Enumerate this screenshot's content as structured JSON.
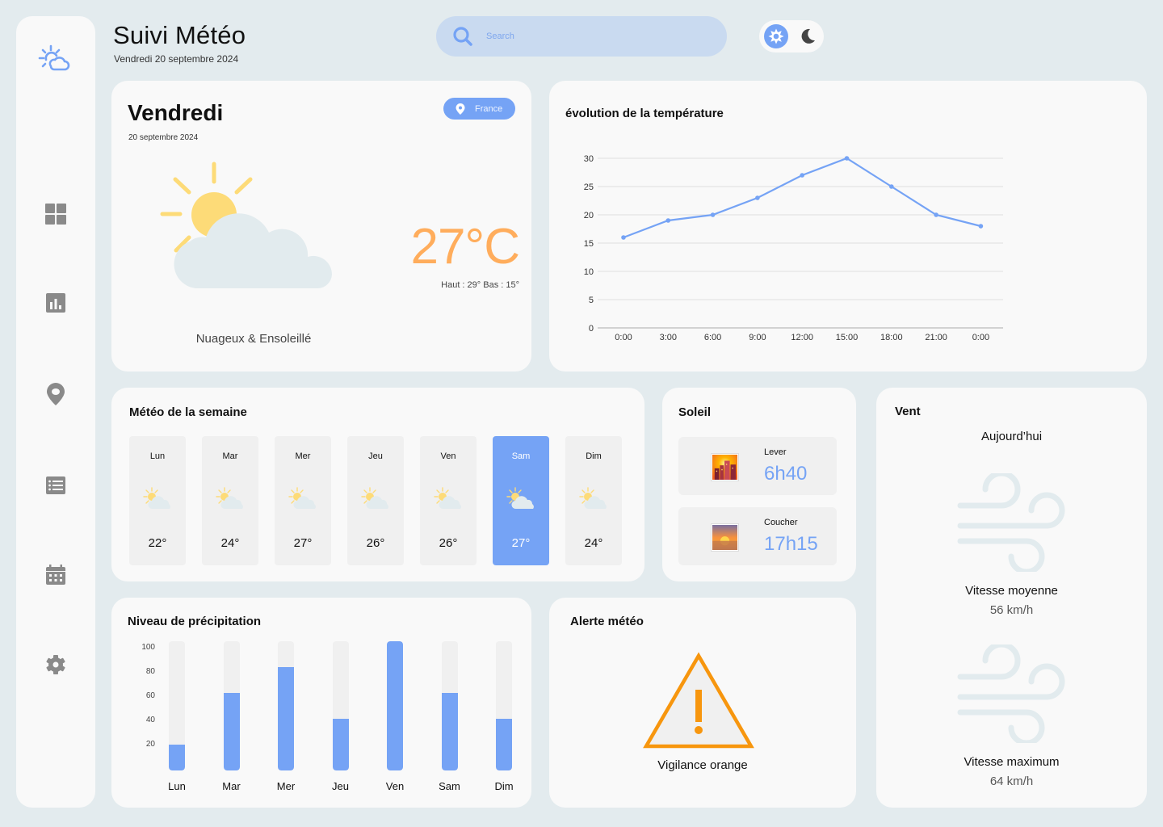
{
  "app": {
    "title": "Suivi Météo",
    "date": "Vendredi 20 septembre 2024"
  },
  "sidebar": {
    "logo": "sun-cloud-icon",
    "items": [
      {
        "id": "dashboard",
        "icon": "grid-icon"
      },
      {
        "id": "stats",
        "icon": "bar-chart-icon"
      },
      {
        "id": "location",
        "icon": "map-pin-icon"
      },
      {
        "id": "list",
        "icon": "list-icon"
      },
      {
        "id": "calendar",
        "icon": "calendar-icon"
      },
      {
        "id": "settings",
        "icon": "gear-icon"
      }
    ]
  },
  "search": {
    "placeholder": "Search",
    "value": ""
  },
  "theme": {
    "light_icon": "sun-icon",
    "dark_icon": "moon-icon",
    "active": "light"
  },
  "today": {
    "day": "Vendredi",
    "date": "20 septembre 2024",
    "location": "France",
    "temperature": "27°C",
    "hi_lo": "Haut : 29° Bas : 15°",
    "condition": "Nuageux & Ensoleillé",
    "icon": "partly-cloudy-icon"
  },
  "colors": {
    "accent": "#75a3f5",
    "temperature": "#ffad5c",
    "sun": "#fddb78",
    "cloud": "#e2ebee",
    "alert": "#f7960e",
    "background": "#e3ebee",
    "card": "#f9f9f9"
  },
  "chart_data": {
    "type": "line",
    "title": "évolution de la température",
    "xlabel": "",
    "ylabel": "",
    "categories": [
      "0:00",
      "3:00",
      "6:00",
      "9:00",
      "12:00",
      "15:00",
      "18:00",
      "21:00",
      "0:00"
    ],
    "series": [
      {
        "name": "Température",
        "values": [
          16,
          19,
          20,
          23,
          27,
          30,
          25,
          20,
          18
        ]
      }
    ],
    "yticks": [
      0,
      5,
      10,
      15,
      20,
      25,
      30
    ],
    "ylim": [
      0,
      30
    ],
    "grid": true,
    "legend": "none"
  },
  "week": {
    "title": "Météo de la semaine",
    "days": [
      {
        "name": "Lun",
        "temp": "22°",
        "active": false
      },
      {
        "name": "Mar",
        "temp": "24°",
        "active": false
      },
      {
        "name": "Mer",
        "temp": "27°",
        "active": false
      },
      {
        "name": "Jeu",
        "temp": "26°",
        "active": false
      },
      {
        "name": "Ven",
        "temp": "26°",
        "active": false
      },
      {
        "name": "Sam",
        "temp": "27°",
        "active": true
      },
      {
        "name": "Dim",
        "temp": "24°",
        "active": false
      }
    ]
  },
  "sun": {
    "title": "Soleil",
    "sunrise_label": "Lever",
    "sunrise": "6h40",
    "sunset_label": "Coucher",
    "sunset": "17h15"
  },
  "wind": {
    "title": "Vent",
    "period": "Aujourd’hui",
    "avg_label": "Vitesse moyenne",
    "avg_value": "56 km/h",
    "max_label": "Vitesse maximum",
    "max_value": "64 km/h"
  },
  "precipitation": {
    "title": "Niveau de précipitation",
    "yticks": [
      "100",
      "80",
      "60",
      "40",
      "20"
    ],
    "days": [
      {
        "name": "Lun",
        "percent": 20
      },
      {
        "name": "Mar",
        "percent": 60
      },
      {
        "name": "Mer",
        "percent": 80
      },
      {
        "name": "Jeu",
        "percent": 40
      },
      {
        "name": "Ven",
        "percent": 100
      },
      {
        "name": "Sam",
        "percent": 60
      },
      {
        "name": "Dim",
        "percent": 40
      }
    ]
  },
  "alert": {
    "title": "Alerte météo",
    "level": "Vigilance orange",
    "icon": "warning-triangle-icon"
  }
}
